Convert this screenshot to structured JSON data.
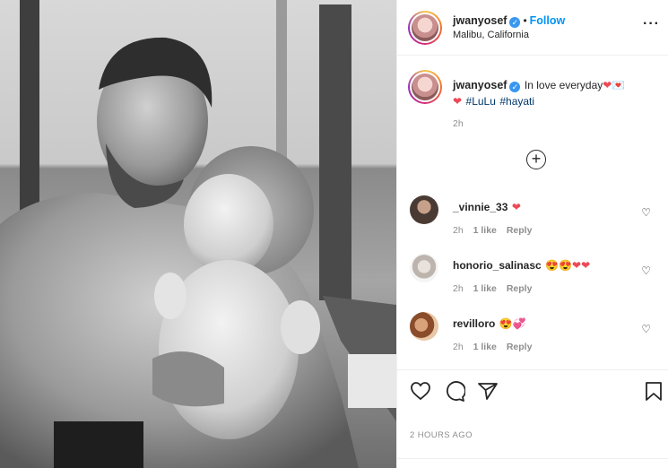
{
  "post": {
    "username": "jwanyosef",
    "follow_label": "Follow",
    "location": "Malibu, California",
    "caption": "In love everyday",
    "hashtags": [
      "#LuLu",
      "#hayati"
    ],
    "caption_time": "2h",
    "time_ago": "2 HOURS AGO"
  },
  "comments": [
    {
      "user": "_vinnie_33",
      "emoji": "❤",
      "time": "2h",
      "likes": "1 like",
      "reply": "Reply"
    },
    {
      "user": "honorio_salinasc",
      "emoji": "😍😍❤❤",
      "time": "2h",
      "likes": "1 like",
      "reply": "Reply"
    },
    {
      "user": "revilloro",
      "emoji": "😍💞",
      "time": "2h",
      "likes": "1 like",
      "reply": "Reply"
    }
  ],
  "icons": {
    "verified": "verified-badge-icon",
    "more": "more-options-icon",
    "load_more": "plus-circle-icon",
    "like": "heart-icon",
    "comment": "comment-icon",
    "share": "paper-plane-icon",
    "save": "bookmark-icon"
  },
  "colors": {
    "accent": "#0095f6",
    "verified": "#3897f0",
    "heart": "#ed4956",
    "muted": "#8e8e8e"
  }
}
